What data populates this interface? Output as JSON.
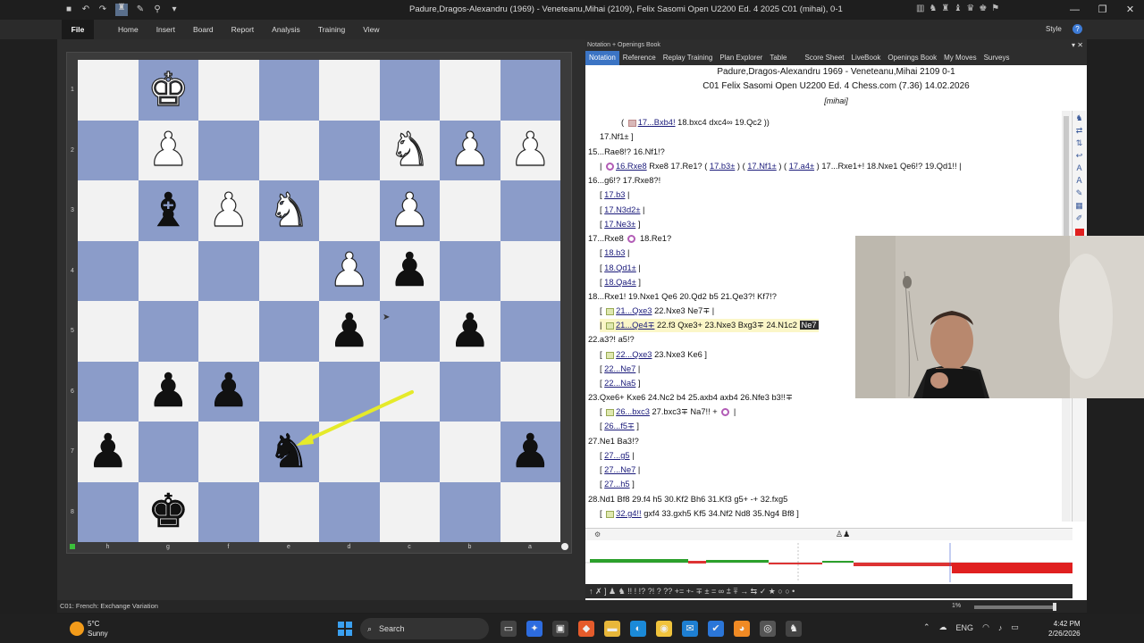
{
  "window": {
    "title": "Padure,Dragos-Alexandru (1969) - Veneteanu,Mihai (2109), Felix Sasomi Open U2200 Ed. 4 2025  C01  (mihai), 0-1"
  },
  "ribbon": {
    "file": "File",
    "tabs": [
      "Home",
      "Insert",
      "Board",
      "Report",
      "Analysis",
      "Training",
      "View"
    ],
    "style": "Style"
  },
  "board": {
    "ranks": [
      "1",
      "2",
      "3",
      "4",
      "5",
      "6",
      "7",
      "8"
    ],
    "files": [
      "h",
      "g",
      "f",
      "e",
      "d",
      "c",
      "b",
      "a"
    ],
    "squares": [
      [
        "",
        "wK",
        "",
        "",
        "",
        "",
        "",
        ""
      ],
      [
        "",
        "wP",
        "",
        "",
        "",
        "wN",
        "wP",
        "wP"
      ],
      [
        "",
        "bB",
        "wP",
        "wN",
        "",
        "wP",
        "",
        ""
      ],
      [
        "",
        "",
        "",
        "",
        "wP",
        "bP",
        "",
        ""
      ],
      [
        "",
        "",
        "",
        "",
        "bP",
        "",
        "bP",
        ""
      ],
      [
        "",
        "bP",
        "bP",
        "",
        "",
        "",
        "",
        ""
      ],
      [
        "bP",
        "",
        "",
        "bN",
        "",
        "",
        "",
        "bP"
      ],
      [
        "",
        "bK",
        "",
        "",
        "",
        "",
        "",
        ""
      ]
    ],
    "arrow_color": "#e5ea2a"
  },
  "notation": {
    "panel_title": "Notation + Openings Book",
    "tabs": [
      "Notation",
      "Reference",
      "Replay Training",
      "Plan Explorer",
      "Table",
      "Score Sheet",
      "LiveBook",
      "Openings Book",
      "My Moves",
      "Surveys"
    ],
    "header_line1": "Padure,Dragos-Alexandru 1969 - Veneteanu,Mihai 2109  0-1",
    "header_line2": "C01 Felix Sasomi Open U2200 Ed. 4 Chess.com (7.36)  14.02.2026",
    "annotator": "[mihai]",
    "lines": {
      "l1_a": "17...Bxb4!",
      "l1_b": "18.bxc4  dxc4∞  19.Qc2 ))",
      "l2": "17.Nf1±  ]",
      "l3": "15...Rae8!?  16.Nf1!?",
      "l4_a": "16.Rxe8",
      "l4_b": "Rxe8  17.Re1?",
      "l4_c": "17.b3±",
      "l4_d": "17.Nf1±",
      "l4_e": "17.a4±",
      "l4_f": "17...Rxe1+!  18.Nxe1  Qe6!?  19.Qd1!! |",
      "l5": "16...g6!?  17.Rxe8?!",
      "l6": "17.b3",
      "l7": "17.N3d2±",
      "l8": "17.Ne3±",
      "l9_a": "17...Rxe8",
      "l9_b": "18.Re1?",
      "l10": "18.b3",
      "l11": "18.Qd1±",
      "l12": "18.Qa4±",
      "l13": "18...Rxe1!  19.Nxe1  Qe6  20.Qd2  b5  21.Qe3?!  Kf7!?",
      "l14_a": "21...Qxe3",
      "l14_b": "22.Nxe3  Ne7∓ |",
      "l15_a": "21...Qe4∓",
      "l15_b": "22.f3  Qxe3+  23.Nxe3  Bxg3∓  24.N1c2",
      "l15_c": "Ne7",
      "l16": "22.a3?!  a5!?",
      "l17_a": "22...Qxe3",
      "l17_b": "23.Nxe3  Ke6 ]",
      "l18": "22...Ne7",
      "l19": "22...Na5",
      "l20": "23.Qxe6+  Kxe6  24.Nc2  b4  25.axb4  axb4  26.Nfe3  b3!!∓",
      "l21_a": "26...bxc3",
      "l21_b": "27.bxc3∓  Na7!! +",
      "l22": "26...f5∓",
      "l23": "27.Ne1  Ba3!?",
      "l24": "27...g5",
      "l25": "27...Ne7",
      "l26": "27...h5",
      "l27": "28.Nd1  Bf8  29.f4  h5  30.Kf2  Bh6  31.Kf3  g5+ -+  32.fxg5",
      "l28_a": "32.g4!!",
      "l28_b": "gxf4  33.gxh5  Kf5  34.Nf2  Nd8  35.Ng4  Bf8 ]"
    }
  },
  "eval_toolbar": "↑ ✗ ] ♟ ♞ !! ! !? ?! ? ?? += +- ∓ ± = ∞ ⩲ ⩱ → ⇆ ✓ ★ ○ ○ •",
  "statusbar": {
    "opening": "C01: French: Exchange Variation",
    "zoom": "1%"
  },
  "taskbar": {
    "temp": "5°C",
    "weather": "Sunny",
    "search": "Search",
    "lang": "ENG",
    "time": "4:42 PM",
    "date": "2/26/2026"
  }
}
